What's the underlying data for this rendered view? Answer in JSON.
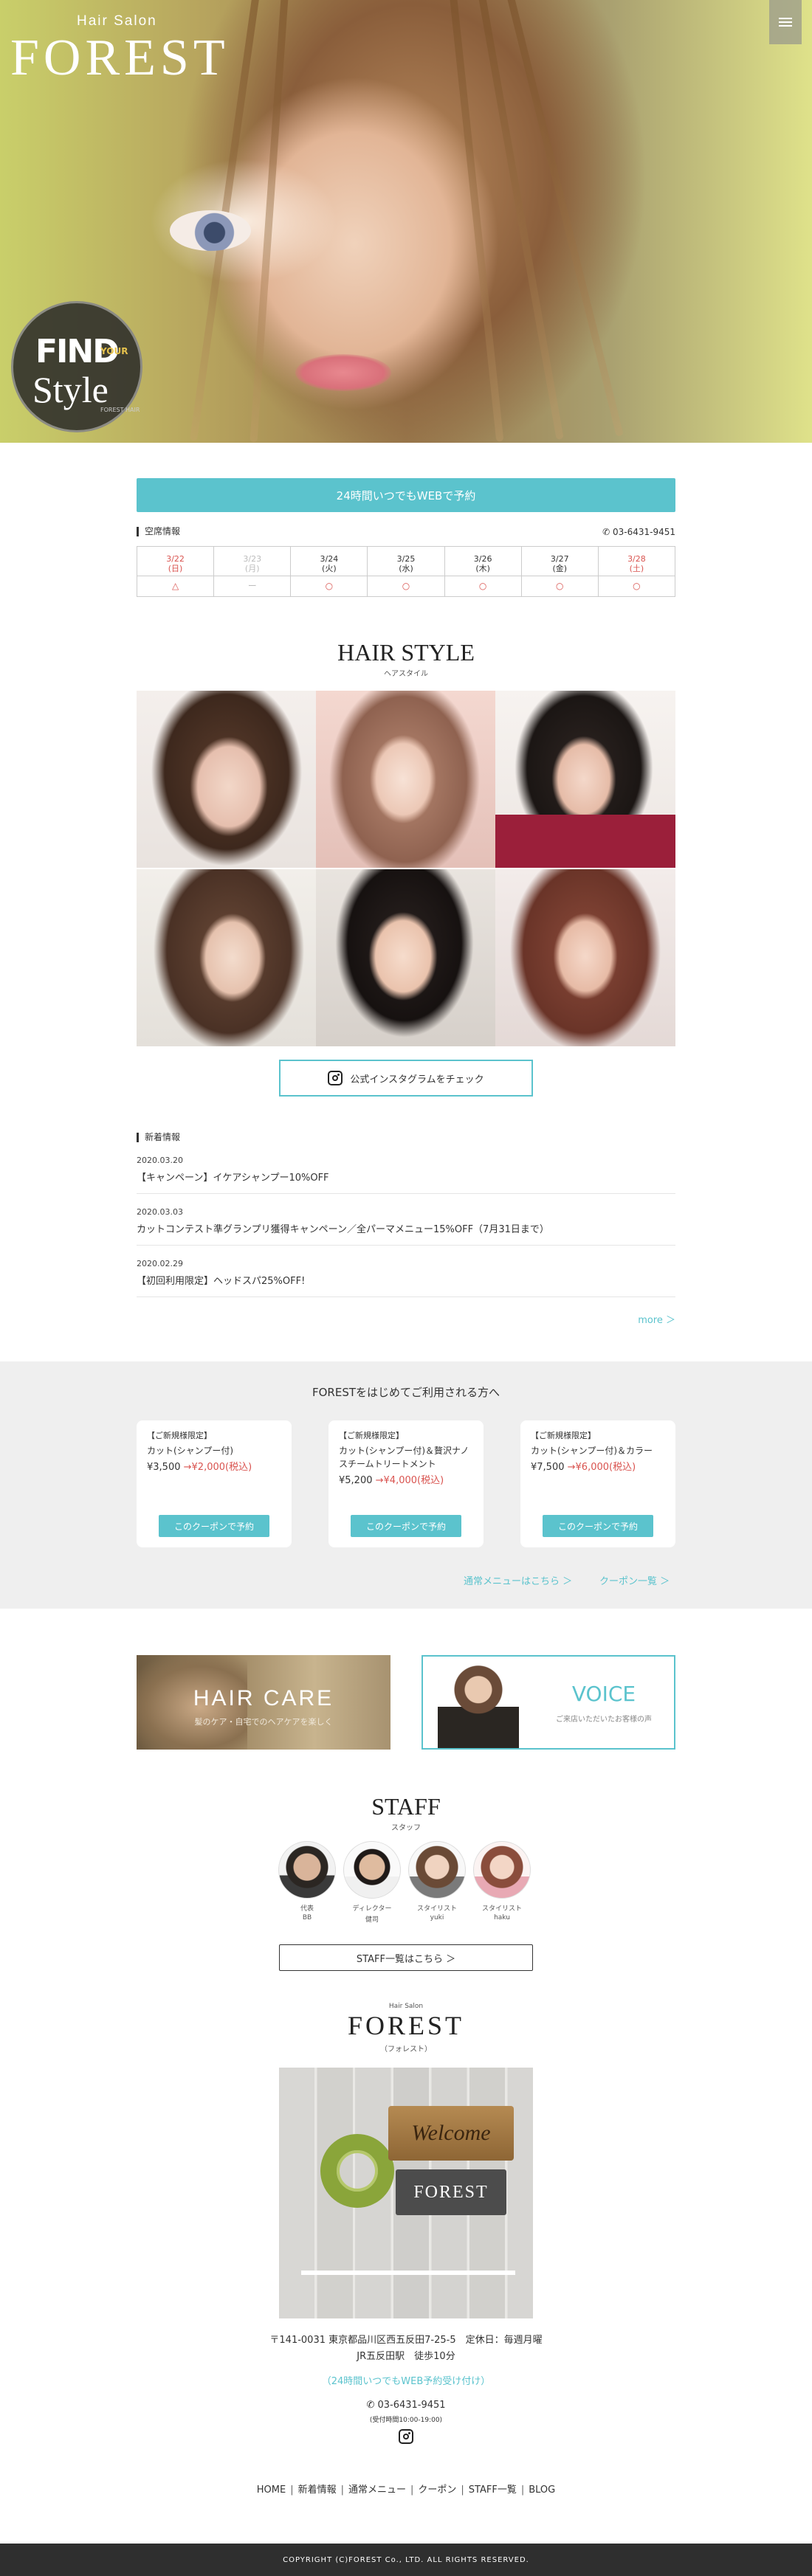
{
  "hero": {
    "brand_small": "Hair Salon",
    "brand_big": "FOREST",
    "badge_find": "FIND",
    "badge_your": "YOUR",
    "badge_style": "Style",
    "badge_hair": "FOREST HAIR"
  },
  "reserve": {
    "button_label": "24時間いつでもWEBで予約",
    "section_label": "空席情報",
    "tel": "03-6431-9451",
    "days": [
      {
        "date": "3/22",
        "dow": "(日)",
        "mark": "△",
        "style": "red"
      },
      {
        "date": "3/23",
        "dow": "(月)",
        "mark": "ー",
        "style": "gray"
      },
      {
        "date": "3/24",
        "dow": "(火)",
        "mark": "○",
        "style": "normal"
      },
      {
        "date": "3/25",
        "dow": "(水)",
        "mark": "○",
        "style": "normal"
      },
      {
        "date": "3/26",
        "dow": "(木)",
        "mark": "○",
        "style": "normal"
      },
      {
        "date": "3/27",
        "dow": "(金)",
        "mark": "○",
        "style": "normal"
      },
      {
        "date": "3/28",
        "dow": "(土)",
        "mark": "○",
        "style": "red"
      }
    ]
  },
  "hairstyle": {
    "title": "HAIR STYLE",
    "subtitle": "ヘアスタイル",
    "insta_label": "公式インスタグラムをチェック"
  },
  "news": {
    "section_label": "新着情報",
    "items": [
      {
        "date": "2020.03.20",
        "title": "【キャンペーン】イケアシャンプー10%OFF"
      },
      {
        "date": "2020.03.03",
        "title": "カットコンテスト準グランプリ獲得キャンペーン／全パーマメニュー15%OFF（7月31日まで）"
      },
      {
        "date": "2020.02.29",
        "title": "【初回利用限定】ヘッドスパ25%OFF!"
      }
    ],
    "more_label": "more ＞"
  },
  "coupons": {
    "heading": "FORESTをはじめてご利用される方へ",
    "items": [
      {
        "category": "【ご新規様限定】",
        "name": "カット(シャンプー付)",
        "price_old": "¥3,500",
        "price_new": "→¥2,000(税込)",
        "button": "このクーポンで予約"
      },
      {
        "category": "【ご新規様限定】",
        "name": "カット(シャンプー付)＆贅沢ナノスチームトリートメント",
        "price_old": "¥5,200",
        "price_new": "→¥4,000(税込)",
        "button": "このクーポンで予約"
      },
      {
        "category": "【ご新規様限定】",
        "name": "カット(シャンプー付)＆カラー",
        "price_old": "¥7,500",
        "price_new": "→¥6,000(税込)",
        "button": "このクーポンで予約"
      }
    ],
    "link_menu": "通常メニューはこちら ＞",
    "link_list": "クーポン一覧 ＞"
  },
  "banners": {
    "haircare_title": "HAIR CARE",
    "haircare_sub": "髪のケア・自宅でのヘアケアを楽しく",
    "voice_title": "VOICE",
    "voice_sub": "ご来店いただいたお客様の声"
  },
  "staff": {
    "title": "STAFF",
    "subtitle": "スタッフ",
    "members": [
      {
        "role": "代表",
        "name": "BB"
      },
      {
        "role": "ディレクター",
        "name": "健司"
      },
      {
        "role": "スタイリスト",
        "name": "yuki"
      },
      {
        "role": "スタイリスト",
        "name": "haku"
      }
    ],
    "button_label": "STAFF一覧はこちら ＞"
  },
  "shop": {
    "brand_small": "Hair Salon",
    "brand_big": "FOREST",
    "brand_kana": "（フォレスト）",
    "sign_welcome": "Welcome",
    "sign_brand": "FOREST",
    "address_line1": "〒141-0031 東京都品川区西五反田7-25-5　定休日：毎週月曜",
    "address_line2": "JR五反田駅　徒歩10分",
    "web_link": "（24時間いつでもWEB予約受け付け）",
    "tel": "03-6431-9451",
    "hours": "(受付時間10:00-19:00)"
  },
  "footer": {
    "nav": [
      "HOME",
      "新着情報",
      "通常メニュー",
      "クーポン",
      "STAFF一覧",
      "BLOG"
    ],
    "copyright": "COPYRIGHT (C)FOREST Co., LTD. ALL RIGHTS RESERVED."
  },
  "colors": {
    "accent": "#5bc3cd",
    "price_red": "#d9534f",
    "footer_bg": "#2f2f2f"
  }
}
